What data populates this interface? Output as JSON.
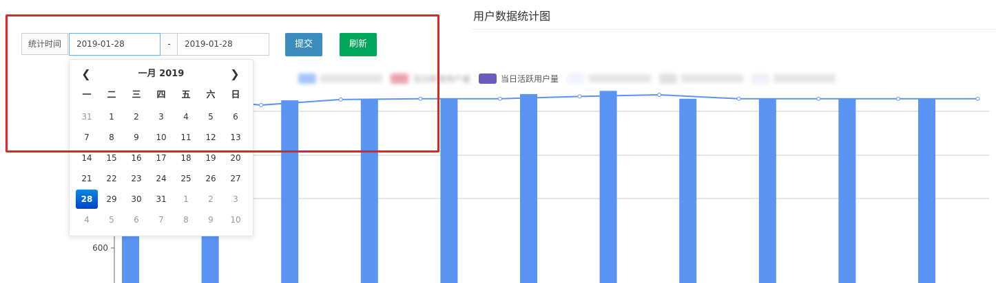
{
  "header": {
    "title": "用户数据统计图"
  },
  "filter": {
    "label": "统计时间",
    "start_date": "2019-01-28",
    "separator": "-",
    "end_date": "2019-01-28",
    "submit_label": "提交",
    "refresh_label": "刷新"
  },
  "datepicker": {
    "title": "一月 2019",
    "weekdays": [
      "一",
      "二",
      "三",
      "四",
      "五",
      "六",
      "日"
    ],
    "selected": "28",
    "weeks": [
      [
        {
          "d": "31",
          "m": true
        },
        {
          "d": "1"
        },
        {
          "d": "2"
        },
        {
          "d": "3"
        },
        {
          "d": "4"
        },
        {
          "d": "5"
        },
        {
          "d": "6"
        }
      ],
      [
        {
          "d": "7"
        },
        {
          "d": "8"
        },
        {
          "d": "9"
        },
        {
          "d": "10"
        },
        {
          "d": "11"
        },
        {
          "d": "12"
        },
        {
          "d": "13"
        }
      ],
      [
        {
          "d": "14"
        },
        {
          "d": "15"
        },
        {
          "d": "16"
        },
        {
          "d": "17"
        },
        {
          "d": "18"
        },
        {
          "d": "19"
        },
        {
          "d": "20"
        }
      ],
      [
        {
          "d": "21"
        },
        {
          "d": "22"
        },
        {
          "d": "23"
        },
        {
          "d": "24"
        },
        {
          "d": "25"
        },
        {
          "d": "26"
        },
        {
          "d": "27"
        }
      ],
      [
        {
          "d": "28",
          "sel": true
        },
        {
          "d": "29"
        },
        {
          "d": "30"
        },
        {
          "d": "31"
        },
        {
          "d": "1",
          "m": true
        },
        {
          "d": "2",
          "m": true
        },
        {
          "d": "3",
          "m": true
        }
      ],
      [
        {
          "d": "4",
          "m": true
        },
        {
          "d": "5",
          "m": true
        },
        {
          "d": "6",
          "m": true
        },
        {
          "d": "7",
          "m": true
        },
        {
          "d": "8",
          "m": true
        },
        {
          "d": "9",
          "m": true
        },
        {
          "d": "10",
          "m": true
        }
      ]
    ]
  },
  "legend": [
    {
      "name": "",
      "color": "#5b94f3",
      "blurred": true
    },
    {
      "name": "当日新增用户量",
      "color": "#d9536c",
      "blurred": true
    },
    {
      "name": "当日活跃用户量",
      "color": "#6a5bbd",
      "blurred": false
    },
    {
      "name": "",
      "color": "#dfe9fb",
      "blurred": true
    },
    {
      "name": "",
      "color": "#c8c8c8",
      "blurred": true
    },
    {
      "name": "",
      "color": "#e6e0f5",
      "blurred": true
    }
  ],
  "chart_data": {
    "type": "bar",
    "y_tick_labels": [
      "600"
    ],
    "bar_color": "#5b94f3",
    "line_color": "#5b94f3",
    "categories": [
      "",
      "",
      "",
      "",
      "",
      "",
      "",
      "",
      "",
      "",
      ""
    ],
    "series": [
      {
        "values": [
          1560,
          1450,
          1540,
          1550,
          1550,
          1580,
          1600,
          1550,
          1550,
          1550,
          1550
        ]
      },
      {
        "values": [
          1560,
          1510,
          1545,
          1550,
          1550,
          1565,
          1575,
          1550,
          1550,
          1550,
          1550
        ]
      }
    ],
    "ylim": [
      380,
      1850
    ],
    "grid": true
  }
}
